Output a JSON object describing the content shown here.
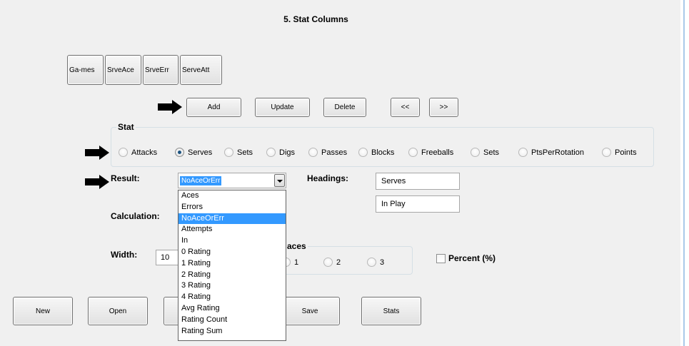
{
  "title": "5. Stat Columns",
  "columns": [
    "Ga-mes",
    "SrveAce",
    "SrveErr",
    "ServeAtt"
  ],
  "actions": {
    "add": "Add",
    "update": "Update",
    "delete": "Delete",
    "prev": "<<",
    "next": ">>"
  },
  "stat": {
    "legend": "Stat",
    "options": [
      {
        "label": "Attacks",
        "selected": false
      },
      {
        "label": "Serves",
        "selected": true
      },
      {
        "label": "Sets",
        "selected": false
      },
      {
        "label": "Digs",
        "selected": false
      },
      {
        "label": "Passes",
        "selected": false
      },
      {
        "label": "Blocks",
        "selected": false
      },
      {
        "label": "Freeballs",
        "selected": false
      },
      {
        "label": "Sets",
        "selected": false
      },
      {
        "label": "PtsPerRotation",
        "selected": false
      },
      {
        "label": "Points",
        "selected": false
      }
    ]
  },
  "result": {
    "label": "Result:",
    "value": "NoAceOrErr",
    "options": [
      "Aces",
      "Errors",
      "NoAceOrErr",
      "Attempts",
      "In",
      "0 Rating",
      "1 Rating",
      "2 Rating",
      "3 Rating",
      "4 Rating",
      "Avg Rating",
      "Rating Count",
      "Rating Sum"
    ],
    "selected_index": 2
  },
  "headings": {
    "label": "Headings:",
    "line1": "Serves",
    "line2": "In Play"
  },
  "calculation": {
    "label": "Calculation:"
  },
  "width": {
    "label": "Width:",
    "value": "10"
  },
  "places": {
    "legend": "aces",
    "options": [
      {
        "label": "1",
        "selected": false
      },
      {
        "label": "2",
        "selected": false
      },
      {
        "label": "3",
        "selected": false
      }
    ]
  },
  "percent": {
    "label": "Percent (%)",
    "checked": false
  },
  "footer": {
    "new": "New",
    "open": "Open",
    "save": "Save",
    "stats": "Stats"
  }
}
